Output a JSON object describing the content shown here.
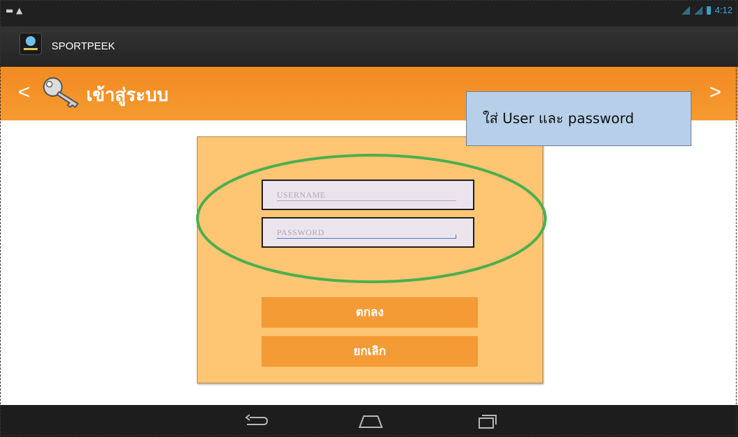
{
  "status_bar": {
    "time": "4:12"
  },
  "app_bar": {
    "title": "SPORTPEEK"
  },
  "header": {
    "title": "เข้าสู่ระบบ",
    "prev": "<",
    "next": ">"
  },
  "callout": {
    "text": "ใส่ User และ password"
  },
  "login": {
    "username_placeholder": "USERNAME",
    "password_placeholder": "PASSWORD",
    "ok_label": "ตกลง",
    "cancel_label": "ยกเลิก"
  },
  "colors": {
    "header_orange": "#f28a22",
    "panel": "#fec672",
    "button": "#f49b36",
    "highlight_ring": "#4caf50",
    "callout_bg": "#b7cfe8"
  },
  "icons": [
    "notification-icon",
    "warning-icon",
    "signal-icon",
    "battery-icon",
    "app-icon",
    "key-icon",
    "back-icon",
    "home-icon",
    "recents-icon"
  ]
}
